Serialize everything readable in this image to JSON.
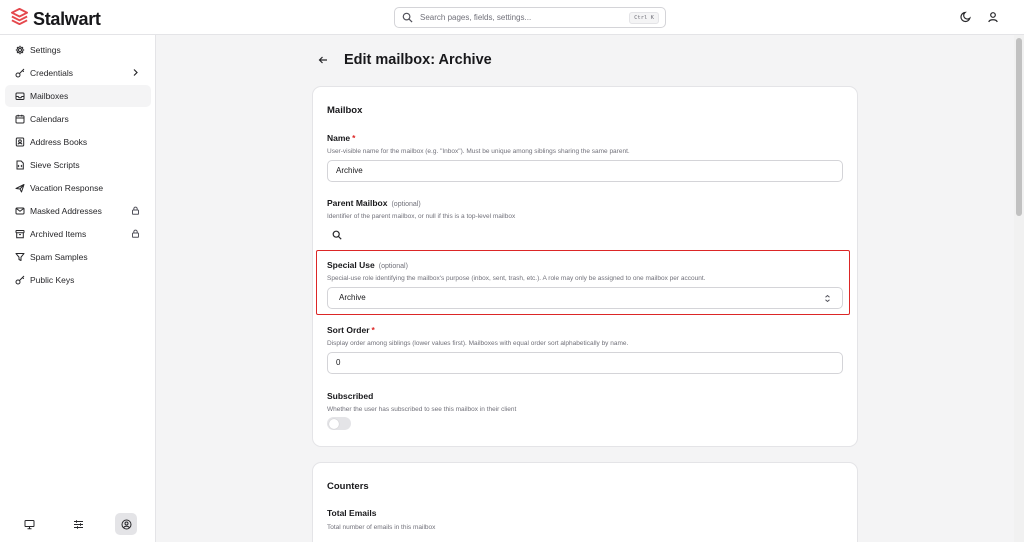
{
  "app": {
    "name": "Stalwart",
    "brand_color": "#e5484d"
  },
  "search": {
    "placeholder": "Search pages, fields, settings...",
    "shortcut": "Ctrl K"
  },
  "header": {
    "icons": [
      "moon-icon",
      "user-icon"
    ]
  },
  "sidebar": {
    "items": [
      {
        "label": "Settings",
        "icon": "gear-icon"
      },
      {
        "label": "Credentials",
        "icon": "key-icon",
        "trailing": "chevron-right-icon"
      },
      {
        "label": "Mailboxes",
        "icon": "inbox-icon",
        "active": true
      },
      {
        "label": "Calendars",
        "icon": "calendar-icon"
      },
      {
        "label": "Address Books",
        "icon": "contact-book-icon"
      },
      {
        "label": "Sieve Scripts",
        "icon": "file-code-icon"
      },
      {
        "label": "Vacation Response",
        "icon": "plane-icon"
      },
      {
        "label": "Masked Addresses",
        "icon": "mail-icon",
        "trailing": "lock-icon"
      },
      {
        "label": "Archived Items",
        "icon": "archive-icon",
        "trailing": "lock-icon"
      },
      {
        "label": "Spam Samples",
        "icon": "filter-icon"
      },
      {
        "label": "Public Keys",
        "icon": "key-icon"
      }
    ],
    "bottom_icons": [
      "monitor-icon",
      "sliders-icon",
      "user-circle-icon"
    ]
  },
  "page": {
    "title": "Edit mailbox: Archive"
  },
  "mailbox_card": {
    "title": "Mailbox",
    "name": {
      "label": "Name",
      "required_mark": "*",
      "description": "User-visible name for the mailbox (e.g. \"Inbox\"). Must be unique among siblings sharing the same parent.",
      "value": "Archive"
    },
    "parent": {
      "label": "Parent Mailbox",
      "optional": "(optional)",
      "description": "Identifier of the parent mailbox, or null if this is a top-level mailbox"
    },
    "special_use": {
      "label": "Special Use",
      "optional": "(optional)",
      "description": "Special-use role identifying the mailbox's purpose (inbox, sent, trash, etc.). A role may only be assigned to one mailbox per account.",
      "value": "Archive"
    },
    "sort_order": {
      "label": "Sort Order",
      "required_mark": "*",
      "description": "Display order among siblings (lower values first). Mailboxes with equal order sort alphabetically by name.",
      "value": "0"
    },
    "subscribed": {
      "label": "Subscribed",
      "description": "Whether the user has subscribed to see this mailbox in their client",
      "checked": false
    }
  },
  "counters_card": {
    "title": "Counters",
    "total_emails": {
      "label": "Total Emails",
      "description": "Total number of emails in this mailbox"
    }
  }
}
